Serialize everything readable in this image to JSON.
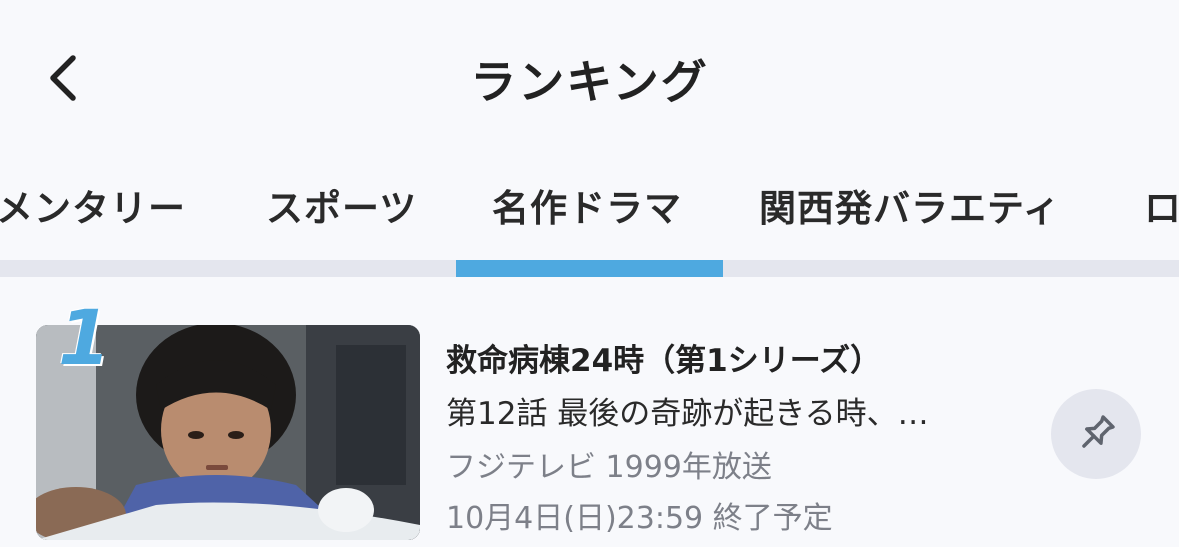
{
  "header": {
    "title": "ランキング",
    "back_icon": "chevron-left-icon"
  },
  "tabs": [
    {
      "label": "メンタリー"
    },
    {
      "label": "スポーツ"
    },
    {
      "label": "名作ドラマ",
      "active": true
    },
    {
      "label": "関西発バラエティ"
    },
    {
      "label": "ロ"
    }
  ],
  "colors": {
    "accent": "#4ea9e0",
    "background": "#f8f9fc",
    "muted_text": "#7d8089",
    "pin_bg": "#e4e6ee"
  },
  "ranking": [
    {
      "rank": "1",
      "title": "救命病棟24時（第1シリーズ）",
      "episode": "第12話 最後の奇跡が起きる時、…",
      "broadcaster": "フジテレビ 1999年放送",
      "availability": "10月4日(日)23:59 終了予定",
      "action_icon": "pin-icon"
    }
  ]
}
